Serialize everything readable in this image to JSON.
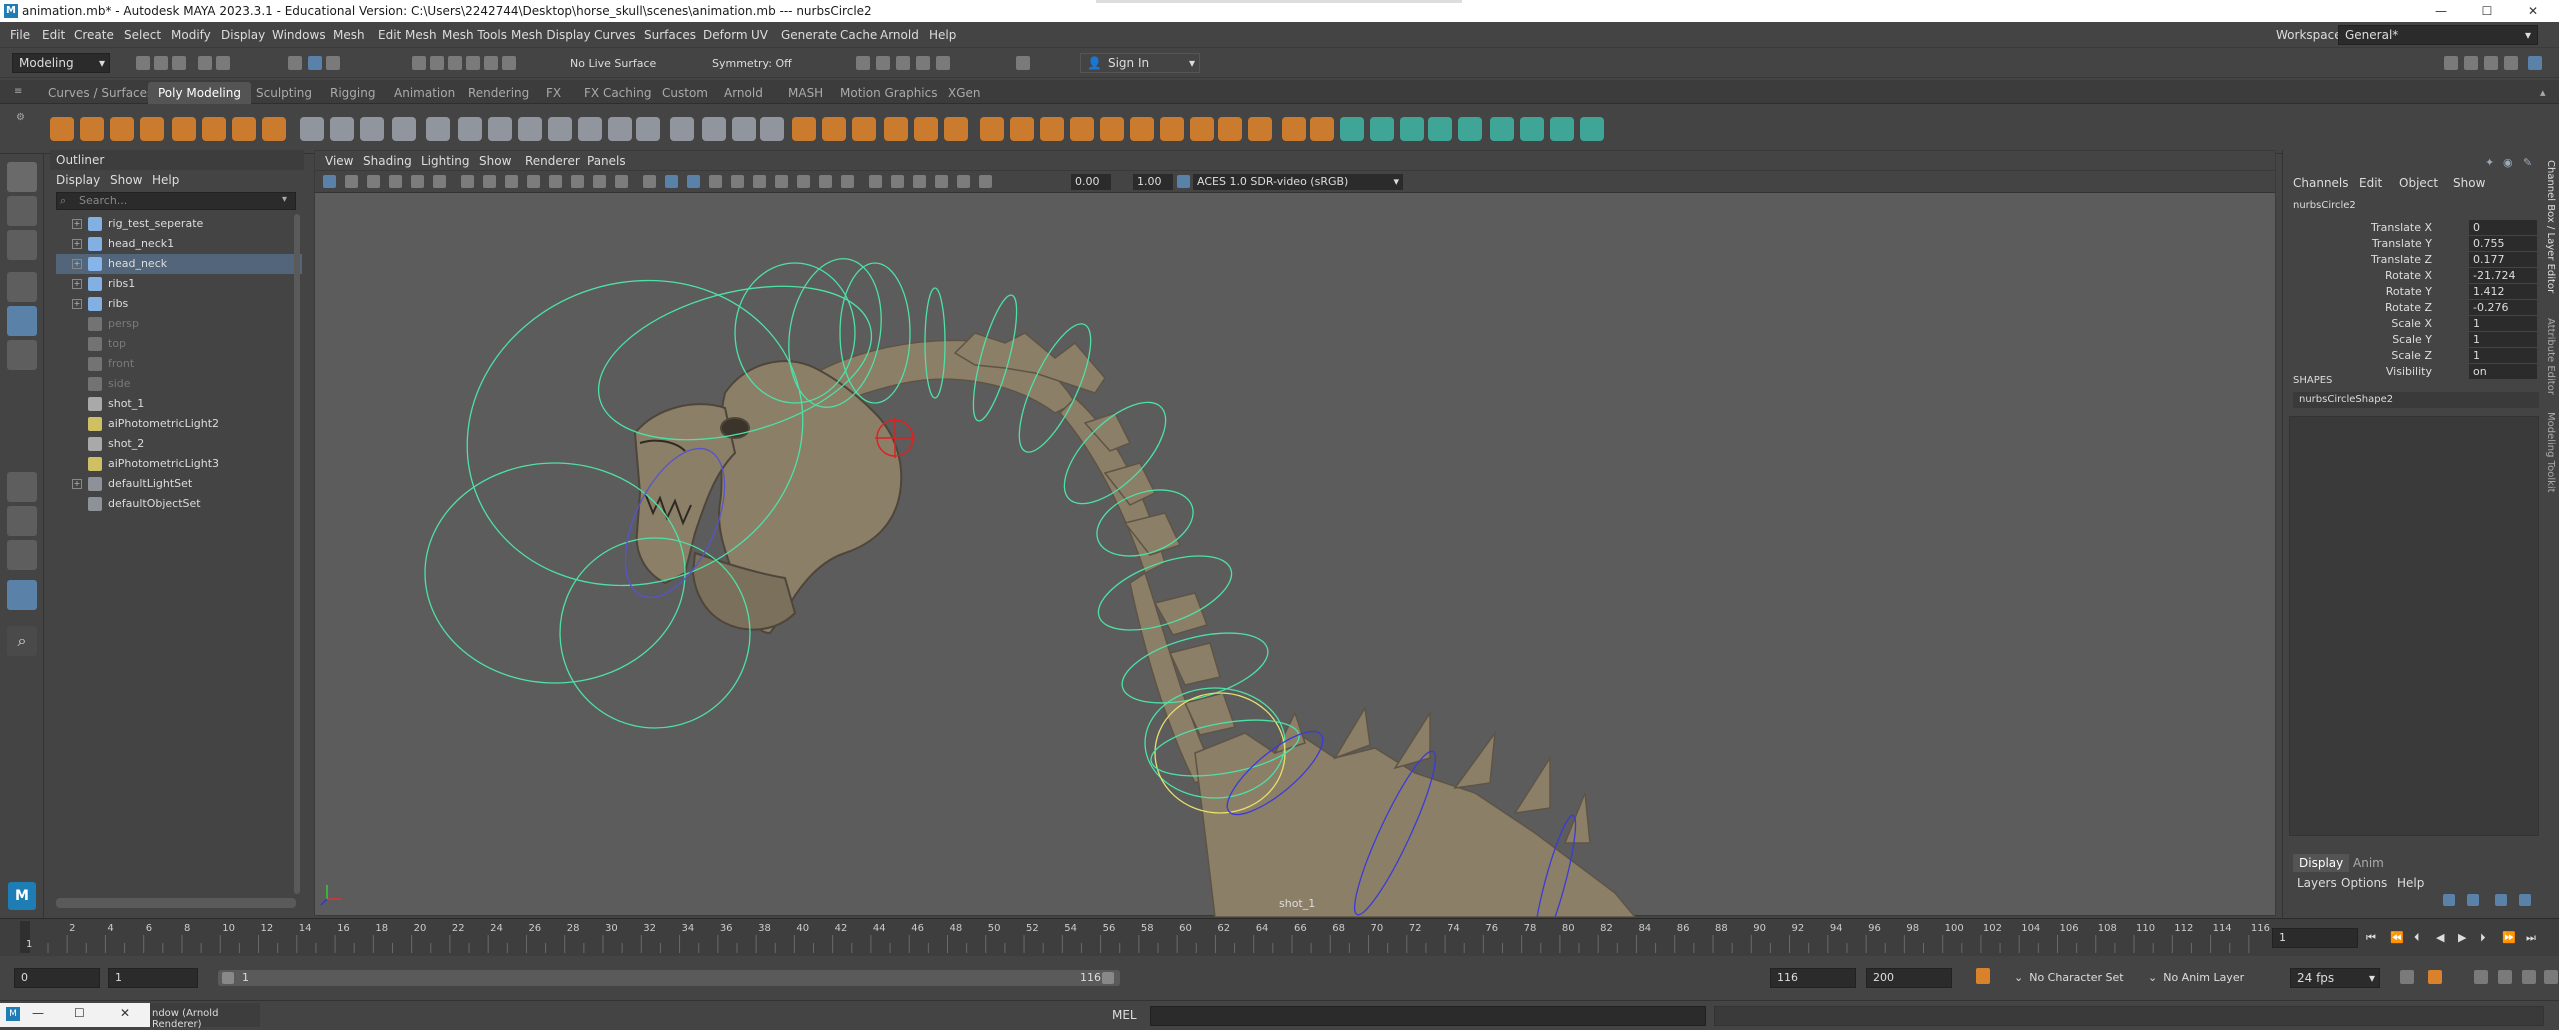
{
  "titlebar": {
    "title": "animation.mb* - Autodesk MAYA 2023.3.1 - Educational Version: C:\\Users\\2242744\\Desktop\\horse_skull\\scenes\\animation.mb  ---  nurbsCircle2",
    "app_icon": "M",
    "minimize": "—",
    "maximize": "☐",
    "close": "✕"
  },
  "menubar": {
    "items": [
      "File",
      "Edit",
      "Create",
      "Select",
      "Modify",
      "Display",
      "Windows",
      "Mesh",
      "Edit Mesh",
      "Mesh Tools",
      "Mesh Display",
      "Curves",
      "Surfaces",
      "Deform",
      "UV",
      "Generate",
      "Cache",
      "Arnold",
      "Help"
    ],
    "workspace_label": "Workspace:",
    "workspace_value": "General*"
  },
  "statusline": {
    "mode": "Modeling",
    "live_surface": "No Live Surface",
    "symmetry": "Symmetry: Off",
    "sign_in": "Sign In"
  },
  "shelf": {
    "tabs": [
      "Curves / Surfaces",
      "Poly Modeling",
      "Sculpting",
      "Rigging",
      "Animation",
      "Rendering",
      "FX",
      "FX Caching",
      "Custom",
      "Arnold",
      "MASH",
      "Motion Graphics",
      "XGen"
    ],
    "active_tab": "Poly Modeling"
  },
  "outliner": {
    "title": "Outliner",
    "menu": [
      "Display",
      "Show",
      "Help"
    ],
    "search_placeholder": "Search...",
    "items": [
      {
        "label": "rig_test_seperate",
        "expand": "+",
        "icon": "joint-icon",
        "state": "normal"
      },
      {
        "label": "head_neck1",
        "expand": "+",
        "icon": "joint-icon",
        "state": "normal"
      },
      {
        "label": "head_neck",
        "expand": "+",
        "icon": "joint-icon",
        "state": "selected"
      },
      {
        "label": "ribs1",
        "expand": "+",
        "icon": "joint-icon",
        "state": "normal"
      },
      {
        "label": "ribs",
        "expand": "+",
        "icon": "joint-icon",
        "state": "normal"
      },
      {
        "label": "persp",
        "expand": "",
        "icon": "camera-icon",
        "state": "dim"
      },
      {
        "label": "top",
        "expand": "",
        "icon": "camera-icon",
        "state": "dim"
      },
      {
        "label": "front",
        "expand": "",
        "icon": "camera-icon",
        "state": "dim"
      },
      {
        "label": "side",
        "expand": "",
        "icon": "camera-icon",
        "state": "dim"
      },
      {
        "label": "shot_1",
        "expand": "",
        "icon": "camera-icon",
        "state": "normal"
      },
      {
        "label": "aiPhotometricLight2",
        "expand": "",
        "icon": "light-icon",
        "state": "normal"
      },
      {
        "label": "shot_2",
        "expand": "",
        "icon": "camera-icon",
        "state": "normal"
      },
      {
        "label": "aiPhotometricLight3",
        "expand": "",
        "icon": "light-icon",
        "state": "normal"
      },
      {
        "label": "defaultLightSet",
        "expand": "+",
        "icon": "set-icon",
        "state": "normal"
      },
      {
        "label": "defaultObjectSet",
        "expand": "",
        "icon": "set-icon",
        "state": "normal"
      }
    ]
  },
  "viewport": {
    "menu": [
      "View",
      "Shading",
      "Lighting",
      "Show",
      "Renderer",
      "Panels"
    ],
    "exposure": "0.00",
    "gamma": "1.00",
    "color_space": "ACES 1.0 SDR-video (sRGB)",
    "camera_name": "shot_1"
  },
  "channel_box": {
    "menu": [
      "Channels",
      "Edit",
      "Object",
      "Show"
    ],
    "object_name": "nurbsCircle2",
    "channels": [
      {
        "label": "Translate X",
        "value": "0"
      },
      {
        "label": "Translate Y",
        "value": "0.755"
      },
      {
        "label": "Translate Z",
        "value": "0.177"
      },
      {
        "label": "Rotate X",
        "value": "-21.724"
      },
      {
        "label": "Rotate Y",
        "value": "1.412"
      },
      {
        "label": "Rotate Z",
        "value": "-0.276"
      },
      {
        "label": "Scale X",
        "value": "1"
      },
      {
        "label": "Scale Y",
        "value": "1"
      },
      {
        "label": "Scale Z",
        "value": "1"
      },
      {
        "label": "Visibility",
        "value": "on"
      }
    ],
    "shapes_header": "SHAPES",
    "shape_name": "nurbsCircleShape2",
    "layer_tabs": [
      "Display",
      "Anim"
    ],
    "layer_menu": [
      "Layers",
      "Options",
      "Help"
    ],
    "side_tabs": [
      "Channel Box / Layer Editor",
      "Attribute Editor",
      "Modeling Toolkit"
    ]
  },
  "timeline": {
    "ticks": [
      "2",
      "4",
      "6",
      "8",
      "10",
      "12",
      "14",
      "16",
      "18",
      "20",
      "22",
      "24",
      "26",
      "28",
      "30",
      "32",
      "34",
      "36",
      "38",
      "40",
      "42",
      "44",
      "46",
      "48",
      "50",
      "52",
      "54",
      "56",
      "58",
      "60",
      "62",
      "64",
      "66",
      "68",
      "70",
      "72",
      "74",
      "76",
      "78",
      "80",
      "82",
      "84",
      "86",
      "88",
      "90",
      "92",
      "94",
      "96",
      "98",
      "100",
      "102",
      "104",
      "106",
      "108",
      "110",
      "112",
      "114",
      "116"
    ],
    "current_frame_marker": "1",
    "current_frame": "1"
  },
  "range": {
    "scene_start": "0",
    "playback_start": "1",
    "range_start": "1",
    "range_end": "116",
    "playback_end": "116",
    "scene_end": "200",
    "character_set": "No Character Set",
    "anim_layer": "No Anim Layer",
    "fps": "24 fps"
  },
  "commandline": {
    "script_window_text": "ndow (Arnold Renderer)",
    "language": "MEL"
  },
  "colors": {
    "accent_orange": "#d9822b",
    "selection_blue": "#52657a",
    "control_green": "#4ee1a6",
    "control_yellow": "#e8e06a",
    "control_blue": "#3b3bd6",
    "bone": "#8c7f68"
  }
}
